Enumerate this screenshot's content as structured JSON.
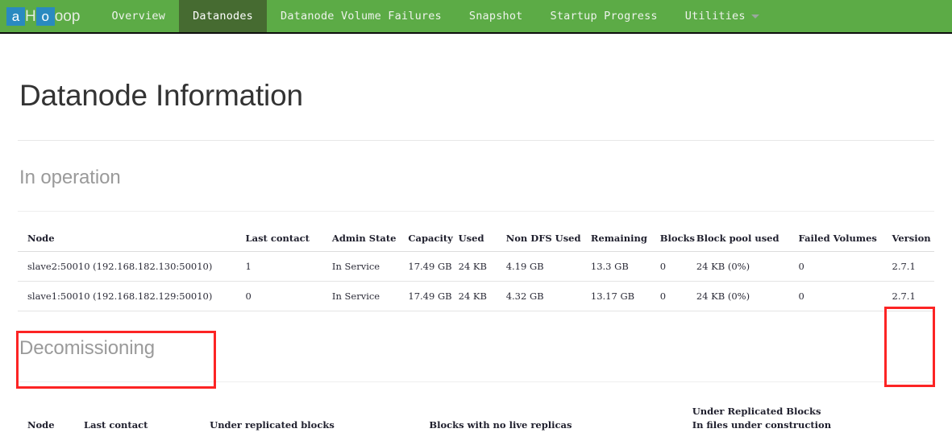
{
  "navbar": {
    "brand": {
      "glyph_1": "a",
      "mid": "H",
      "glyph_2": "o",
      "tail": "oop"
    },
    "items": [
      {
        "label": "Overview",
        "active": false,
        "caret": false
      },
      {
        "label": "Datanodes",
        "active": true,
        "caret": false
      },
      {
        "label": "Datanode Volume Failures",
        "active": false,
        "caret": false
      },
      {
        "label": "Snapshot",
        "active": false,
        "caret": false
      },
      {
        "label": "Startup Progress",
        "active": false,
        "caret": false
      },
      {
        "label": "Utilities",
        "active": false,
        "caret": true
      }
    ],
    "colors": {
      "background": "#5cab46",
      "active_background": "#466b31",
      "text": "#eef3ec",
      "brand_highlight": "#2a8ac0"
    }
  },
  "page": {
    "title": "Datanode Information",
    "in_operation_title": "In operation",
    "decommissioning_title": "Decomissioning"
  },
  "in_operation": {
    "columns": [
      "Node",
      "Last contact",
      "Admin State",
      "Capacity",
      "Used",
      "Non DFS Used",
      "Remaining",
      "Blocks",
      "Block pool used",
      "Failed Volumes",
      "Version"
    ],
    "rows": [
      {
        "node": "slave2:50010 (192.168.182.130:50010)",
        "last_contact": "1",
        "admin_state": "In Service",
        "capacity": "17.49 GB",
        "used": "24 KB",
        "non_dfs_used": "4.19 GB",
        "remaining": "13.3 GB",
        "blocks": "0",
        "block_pool_used": "24 KB (0%)",
        "failed_volumes": "0",
        "version": "2.7.1"
      },
      {
        "node": "slave1:50010 (192.168.182.129:50010)",
        "last_contact": "0",
        "admin_state": "In Service",
        "capacity": "17.49 GB",
        "used": "24 KB",
        "non_dfs_used": "4.32 GB",
        "remaining": "13.17 GB",
        "blocks": "0",
        "block_pool_used": "24 KB (0%)",
        "failed_volumes": "0",
        "version": "2.7.1"
      }
    ]
  },
  "decommissioning": {
    "columns": [
      "Node",
      "Last contact",
      "Under replicated blocks",
      "Blocks with no live replicas",
      "Under Replicated Blocks"
    ],
    "last_column_line2": "In files under construction",
    "rows": []
  },
  "annotations": {
    "color": "#fc2424",
    "boxes": [
      {
        "name": "node-column-highlight"
      },
      {
        "name": "version-column-highlight"
      }
    ]
  }
}
